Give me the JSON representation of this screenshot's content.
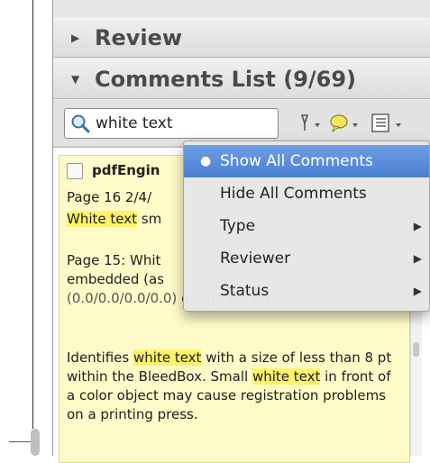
{
  "panel": {
    "review_header": "Review",
    "comments_header": "Comments List (9/69)"
  },
  "toolbar": {
    "search_value": "white text",
    "icons": [
      "search-icon",
      "pen-icon",
      "comment-icon",
      "options-icon"
    ]
  },
  "comment": {
    "author": "pdfEngin",
    "meta": "Page 16  2/4/",
    "highlight_line_prefix": "White text",
    "highlight_line_rest": " sm",
    "page15_line1": "Page 15: Whit",
    "page15_line2": "embedded (as",
    "page15_line3": "(0.0/0.0/0.0/0.0)   overprint: on",
    "para_part1": "Identifies ",
    "para_hl1": "white text",
    "para_part2": " with a size of less than 8 pt within the BleedBox. Small ",
    "para_hl2": "white text",
    "para_part3": " in front of a color object may cause registration problems on a printing press."
  },
  "menu": {
    "items": [
      {
        "label": "Show All Comments",
        "selected": true,
        "submenu": false
      },
      {
        "label": "Hide All Comments",
        "selected": false,
        "submenu": false
      },
      {
        "label": "Type",
        "selected": false,
        "submenu": true
      },
      {
        "label": "Reviewer",
        "selected": false,
        "submenu": true
      },
      {
        "label": "Status",
        "selected": false,
        "submenu": true
      }
    ]
  },
  "colors": {
    "comment_bg": "#fffbc8",
    "highlight": "#fff26b",
    "menu_selected": "#4a7fd3"
  }
}
